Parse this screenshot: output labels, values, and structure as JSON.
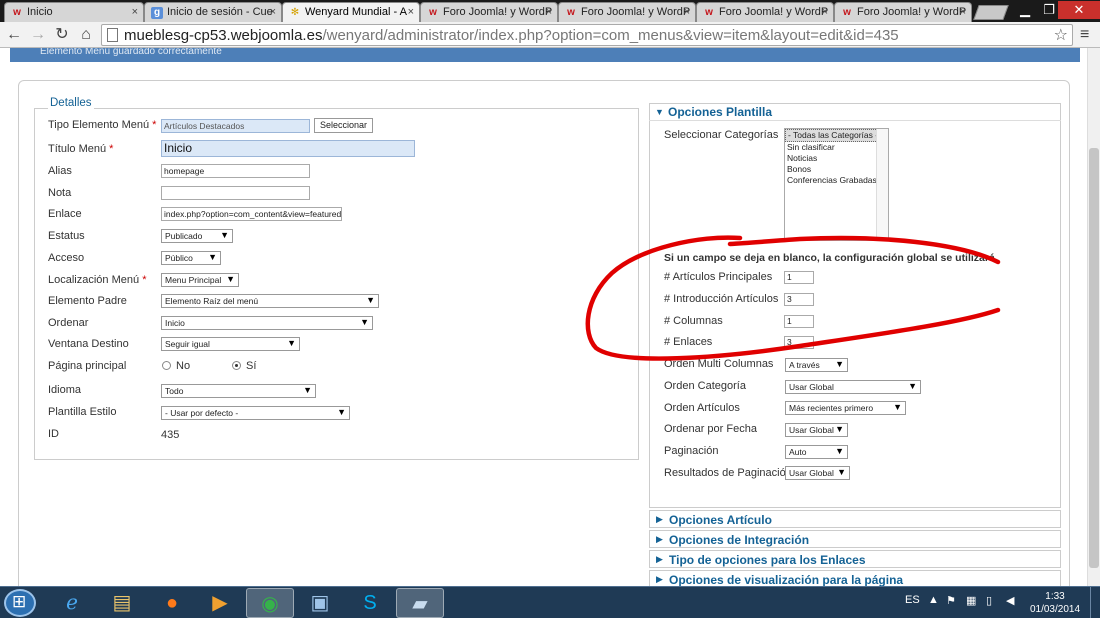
{
  "browser": {
    "tabs": [
      {
        "label": "Inicio",
        "icon": "joomla-w-icon"
      },
      {
        "label": "Inicio de sesión - Cue",
        "icon": "google-g-icon"
      },
      {
        "label": "Wenyard Mundial - A",
        "icon": "spider-icon"
      },
      {
        "label": "Foro Joomla! y WordP",
        "icon": "joomla-w-icon"
      },
      {
        "label": "Foro Joomla! y WordP",
        "icon": "joomla-w-icon"
      },
      {
        "label": "Foro Joomla! y WordP",
        "icon": "joomla-w-icon"
      },
      {
        "label": "Foro Joomla! y WordP",
        "icon": "joomla-w-icon"
      }
    ],
    "tab_close": "×",
    "url_host": "mueblesg-cp53.webjoomla.es",
    "url_path": "/wenyard/administrator/index.php?option=com_menus&view=item&layout=edit&id=435",
    "star": "☆",
    "menu_icon": "≡",
    "back": "←",
    "forward": "→",
    "reload": "↻",
    "home": "⌂",
    "win_min": "▁",
    "win_max": "❐",
    "win_close": "✕"
  },
  "message": "Elemento Menú guardado correctamente",
  "details": {
    "legend": "Detalles",
    "fields": {
      "tipo_label": "Tipo Elemento Menú",
      "tipo_value": "Artículos Destacados",
      "seleccionar": "Seleccionar",
      "titulo_label": "Título Menú",
      "titulo_value": "Inicio",
      "alias_label": "Alias",
      "alias_value": "homepage",
      "nota_label": "Nota",
      "nota_value": "",
      "enlace_label": "Enlace",
      "enlace_value": "index.php?option=com_content&view=featured",
      "estatus_label": "Estatus",
      "estatus_value": "Publicado",
      "acceso_label": "Acceso",
      "acceso_value": "Público",
      "localizacion_label": "Localización Menú",
      "localizacion_value": "Menu Principal",
      "padre_label": "Elemento Padre",
      "padre_value": "Elemento Raíz del menú",
      "ordenar_label": "Ordenar",
      "ordenar_value": "Inicio",
      "ventana_label": "Ventana Destino",
      "ventana_value": "Seguir igual",
      "pagina_label": "Página principal",
      "pagina_no": "No",
      "pagina_si": "Sí",
      "idioma_label": "Idioma",
      "idioma_value": "Todo",
      "plantilla_label": "Plantilla Estilo",
      "plantilla_value": "- Usar por defecto -",
      "id_label": "ID",
      "id_value": "435",
      "asterisk": "*",
      "arrow": "▼"
    }
  },
  "opciones": {
    "title": "Opciones Plantilla",
    "categorias_label": "Seleccionar Categorías",
    "categorias": [
      "- Todas las Categorías -",
      "Sin clasificar",
      "Noticias",
      "Bonos",
      "Conferencias Grabadas"
    ],
    "note": "Si un campo se deja en blanco, la configuración global se utilizará.",
    "rows": {
      "principales_label": "# Artículos Principales",
      "principales_value": "1",
      "introduccion_label": "# Introducción Artículos",
      "introduccion_value": "3",
      "columnas_label": "# Columnas",
      "columnas_value": "1",
      "enlaces_label": "# Enlaces",
      "enlaces_value": "3",
      "multicol_label": "Orden Multi Columnas",
      "multicol_value": "A través",
      "categoria_label": "Orden Categoría",
      "categoria_value": "Usar Global",
      "articulos_label": "Orden Artículos",
      "articulos_value": "Más recientes primero",
      "fecha_label": "Ordenar por Fecha",
      "fecha_value": "Usar Global",
      "paginacion_label": "Paginación",
      "paginacion_value": "Auto",
      "resultados_label": "Resultados de Paginación",
      "resultados_value": "Usar Global"
    }
  },
  "accordions": [
    "Opciones Artículo",
    "Opciones de Integración",
    "Tipo de opciones para los Enlaces",
    "Opciones de visualización para la página"
  ],
  "taskbar": {
    "lang": "ES",
    "time": "1:33",
    "date": "01/03/2014"
  },
  "colors": {
    "accent": "#146295",
    "annotation": "#e00000",
    "taskbar": "#1f3a55"
  }
}
